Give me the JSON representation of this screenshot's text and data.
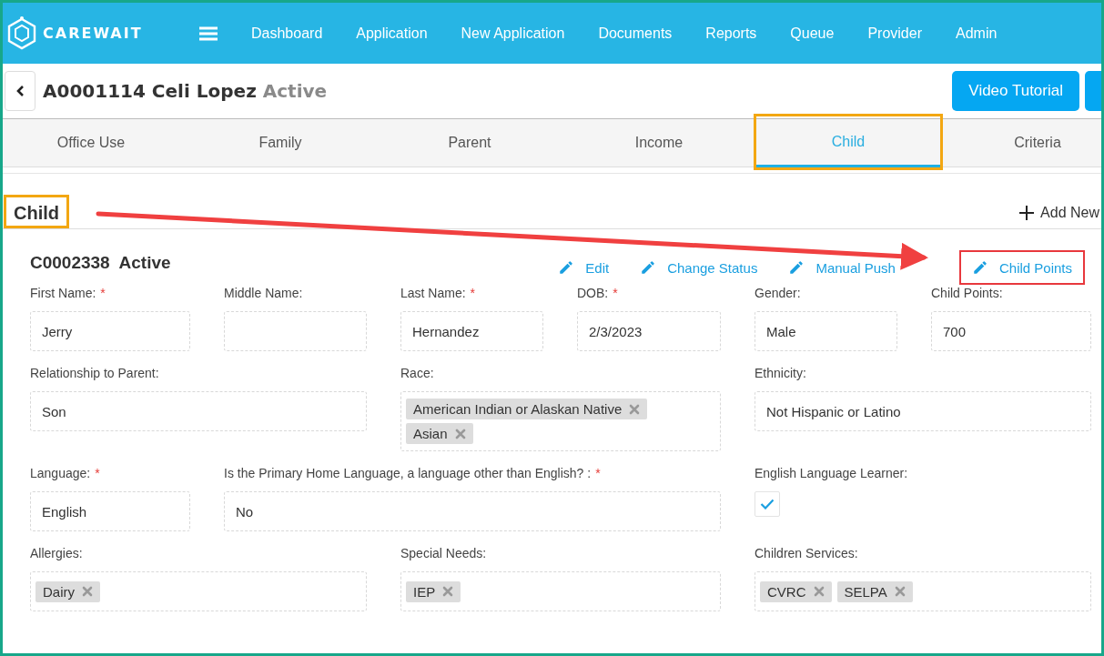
{
  "brand": {
    "name": "CAREWAIT"
  },
  "nav": [
    "Dashboard",
    "Application",
    "New Application",
    "Documents",
    "Reports",
    "Queue",
    "Provider",
    "Admin"
  ],
  "header": {
    "title": "A0001114 Celi Lopez",
    "status": "Active",
    "buttons": [
      {
        "kind": "labeled",
        "label": "Video Tutorial"
      },
      {
        "kind": "cut"
      }
    ]
  },
  "tabs": [
    {
      "label": "Office Use",
      "selected": false,
      "highlighted": false
    },
    {
      "label": "Family",
      "selected": false,
      "highlighted": false
    },
    {
      "label": "Parent",
      "selected": false,
      "highlighted": false
    },
    {
      "label": "Income",
      "selected": false,
      "highlighted": false
    },
    {
      "label": "Child",
      "selected": true,
      "highlighted": true
    },
    {
      "label": "Criteria",
      "selected": false,
      "highlighted": false
    }
  ],
  "section": {
    "title": "Child",
    "highlighted": true,
    "add_label": "Add New"
  },
  "child": {
    "heading": "C0002338  Active",
    "actions": [
      {
        "label": "Edit",
        "highlighted": false
      },
      {
        "label": "Change Status",
        "highlighted": false
      },
      {
        "label": "Manual Push",
        "highlighted": false
      },
      {
        "label": "Child Points",
        "highlighted": true
      }
    ]
  },
  "rows": [
    [
      {
        "label": "First Name:",
        "required_mark": "*",
        "kind": "text",
        "value": "Jerry"
      },
      {
        "label": "Middle Name:",
        "kind": "text"
      },
      {
        "label": "Last Name:",
        "required_mark": "*",
        "kind": "text",
        "value": "Hernandez"
      },
      {
        "label": "DOB:",
        "required_mark": "*",
        "kind": "text",
        "value": "2/3/2023"
      },
      {
        "label": "Gender:",
        "kind": "text",
        "value": "Male"
      },
      {
        "label": "Child Points:",
        "kind": "text",
        "value": "700"
      }
    ],
    [
      {
        "label": "Relationship to Parent:",
        "kind": "text",
        "value": "Son"
      },
      {
        "label": "Race:",
        "kind": "tags",
        "tags": [
          "American Indian or Alaskan Native",
          "Asian"
        ]
      },
      {
        "label": "Ethnicity:",
        "kind": "text",
        "value": "Not Hispanic or Latino"
      }
    ],
    [
      {
        "label": "Language:",
        "required_mark": "*",
        "kind": "text",
        "value": "English"
      },
      {
        "label": "Is the Primary Home Language, a language other than English? :",
        "required_mark": "*",
        "kind": "text",
        "value": "No"
      },
      {
        "label": "English Language Learner:",
        "kind": "checkbox",
        "checked": true
      }
    ],
    [
      {
        "label": "Allergies:",
        "kind": "tags",
        "tags": [
          "Dairy"
        ]
      },
      {
        "label": "Special Needs:",
        "kind": "tags",
        "tags": [
          "IEP"
        ]
      },
      {
        "label": "Children Services:",
        "kind": "tags",
        "tags": [
          "CVRC",
          "SELPA"
        ]
      }
    ]
  ]
}
